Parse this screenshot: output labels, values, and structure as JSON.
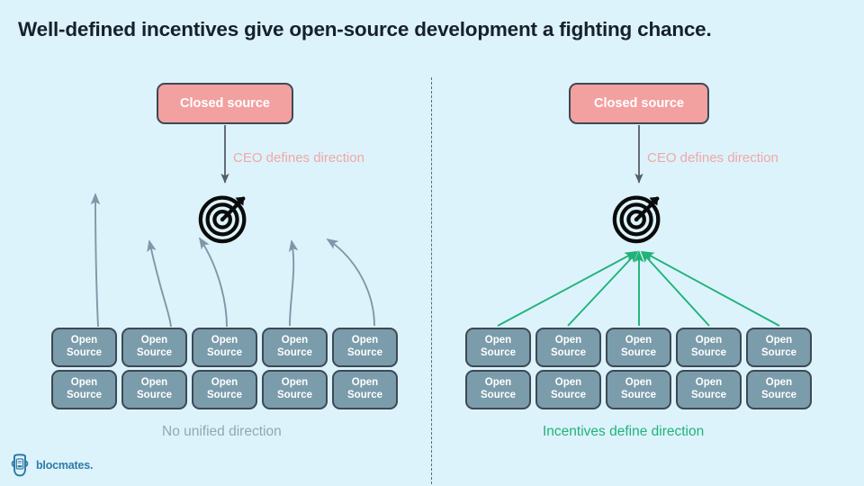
{
  "page": {
    "title": "Well-defined incentives give open-source development a fighting chance.",
    "background_color": "#ddf3fb"
  },
  "colors": {
    "background": "#ddf3fb",
    "title_text": "#16212b",
    "closed_source_fill": "#f3a0a0",
    "closed_source_border": "#3c4a55",
    "open_source_fill": "#7b9cab",
    "open_source_border": "#3c4a55",
    "ceo_label": "#f3a7a7",
    "scatter_arrow": "#7e98a8",
    "converge_arrow": "#21b27a",
    "caption_left": "#93a7b1",
    "caption_right": "#21b27a",
    "divider": "#5b6b75",
    "logo_text": "#2e7ca8"
  },
  "panels": {
    "left": {
      "closed_source_label": "Closed source",
      "ceo_label": "CEO defines direction",
      "target_icon": "target-icon",
      "caption": "No unified direction",
      "open_source_boxes": [
        {
          "line1": "Open",
          "line2": "Source"
        },
        {
          "line1": "Open",
          "line2": "Source"
        },
        {
          "line1": "Open",
          "line2": "Source"
        },
        {
          "line1": "Open",
          "line2": "Source"
        },
        {
          "line1": "Open",
          "line2": "Source"
        },
        {
          "line1": "Open",
          "line2": "Source"
        },
        {
          "line1": "Open",
          "line2": "Source"
        },
        {
          "line1": "Open",
          "line2": "Source"
        },
        {
          "line1": "Open",
          "line2": "Source"
        },
        {
          "line1": "Open",
          "line2": "Source"
        }
      ]
    },
    "right": {
      "closed_source_label": "Closed source",
      "ceo_label": "CEO defines direction",
      "target_icon": "target-icon",
      "caption": "Incentives define direction",
      "open_source_boxes": [
        {
          "line1": "Open",
          "line2": "Source"
        },
        {
          "line1": "Open",
          "line2": "Source"
        },
        {
          "line1": "Open",
          "line2": "Source"
        },
        {
          "line1": "Open",
          "line2": "Source"
        },
        {
          "line1": "Open",
          "line2": "Source"
        },
        {
          "line1": "Open",
          "line2": "Source"
        },
        {
          "line1": "Open",
          "line2": "Source"
        },
        {
          "line1": "Open",
          "line2": "Source"
        },
        {
          "line1": "Open",
          "line2": "Source"
        },
        {
          "line1": "Open",
          "line2": "Source"
        }
      ]
    }
  },
  "logo": {
    "name": "blocmates-logo",
    "text": "blocmates."
  }
}
